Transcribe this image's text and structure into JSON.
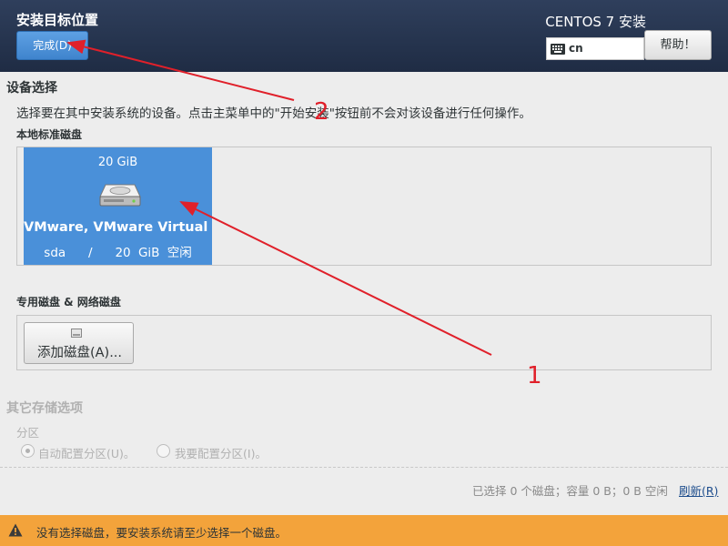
{
  "header": {
    "title": "安装目标位置",
    "done_button": "完成(D)",
    "product": "CENTOS 7 安装",
    "keyboard_layout": "cn",
    "help_button": "帮助！"
  },
  "device_selection": {
    "title": "设备选择",
    "instructions": "选择要在其中安装系统的设备。点击主菜单中的\"开始安装\"按钮前不会对该设备进行任何操作。"
  },
  "local_disks": {
    "heading": "本地标准磁盘",
    "disks": [
      {
        "size": "20 GiB",
        "name": "VMware, VMware Virtual S",
        "info": "sda   /   20 GiB 空闲",
        "selected": true,
        "icon": "hard-disk-icon"
      }
    ]
  },
  "specialized_disks": {
    "heading": "专用磁盘 & 网络磁盘",
    "add_button": "添加磁盘(A)..."
  },
  "other_options": {
    "title": "其它存储选项",
    "partition_label": "分区",
    "auto_partition": "自动配置分区(U)。",
    "manual_partition": "我要配置分区(I)。",
    "auto_selected": true
  },
  "footer": {
    "summary": "已选择 0 个磁盘；容量 0 B；0 B 空闲",
    "refresh": "刷新(R)"
  },
  "warning": {
    "text": "没有选择磁盘，要安装系统请至少选择一个磁盘。",
    "icon": "warning-icon"
  },
  "annotations": {
    "label_1": "1",
    "label_2": "2",
    "color": "#e0202a"
  },
  "colors": {
    "header_bg": "#253450",
    "accent_blue": "#4a90d9",
    "warning_bg": "#f3a33b"
  }
}
